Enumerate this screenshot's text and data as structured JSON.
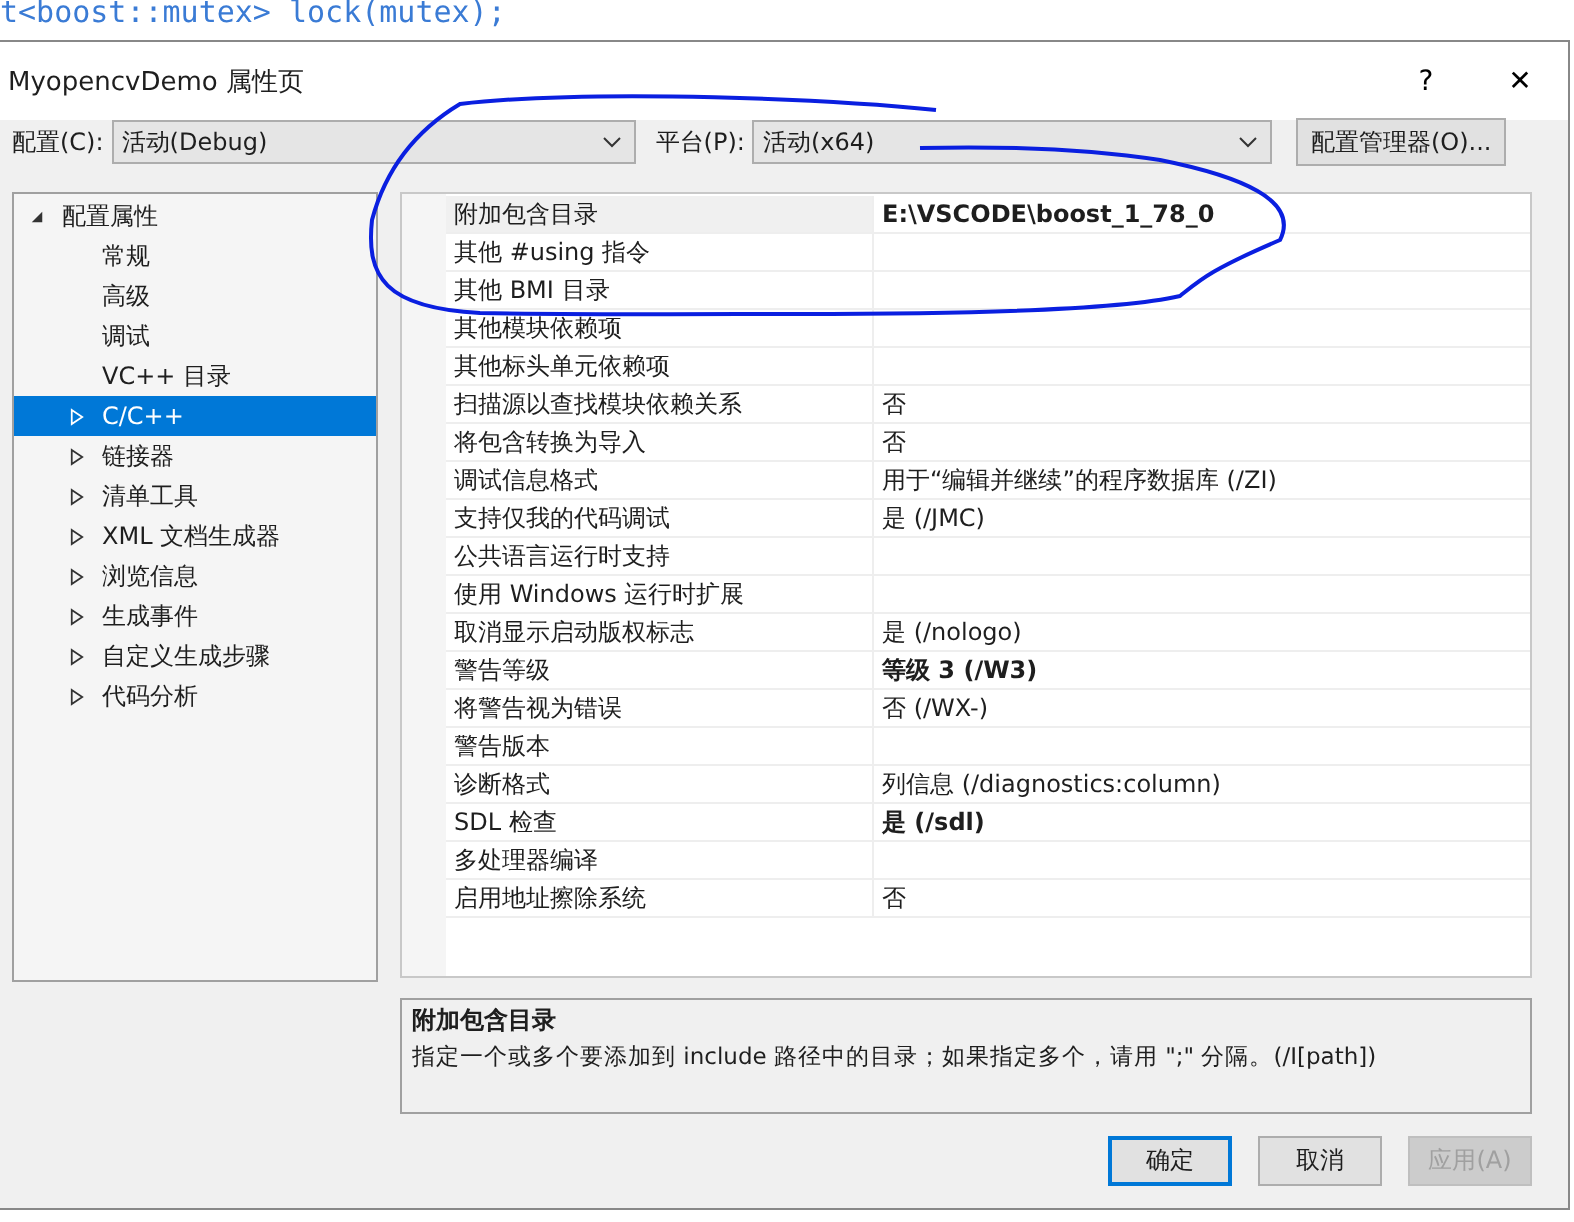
{
  "background_code": "t<boost::mutex> lock(mutex);",
  "window": {
    "title": "MyopencvDemo 属性页",
    "help": "?",
    "close": "✕"
  },
  "config_bar": {
    "config_label": "配置(C):",
    "config_value": "活动(Debug)",
    "platform_label": "平台(P):",
    "platform_value": "活动(x64)",
    "manager_button": "配置管理器(O)..."
  },
  "sidebar": {
    "items": [
      {
        "label": "配置属性",
        "expanded": true,
        "selected": false,
        "children": [
          {
            "label": "常规",
            "selected": false
          },
          {
            "label": "高级",
            "selected": false
          },
          {
            "label": "调试",
            "selected": false
          },
          {
            "label": "VC++ 目录",
            "selected": false
          },
          {
            "label": "C/C++",
            "expanded": false,
            "selected": true
          },
          {
            "label": "链接器",
            "expanded": false,
            "selected": false
          },
          {
            "label": "清单工具",
            "expanded": false,
            "selected": false
          },
          {
            "label": "XML 文档生成器",
            "expanded": false,
            "selected": false
          },
          {
            "label": "浏览信息",
            "expanded": false,
            "selected": false
          },
          {
            "label": "生成事件",
            "expanded": false,
            "selected": false
          },
          {
            "label": "自定义生成步骤",
            "expanded": false,
            "selected": false
          },
          {
            "label": "代码分析",
            "expanded": false,
            "selected": false
          }
        ]
      }
    ]
  },
  "properties": [
    {
      "name": "附加包含目录",
      "value": "E:\\VSCODE\\boost_1_78_0",
      "bold": true,
      "selected": true
    },
    {
      "name": "其他 #using 指令",
      "selected": false
    },
    {
      "name": "其他 BMI 目录",
      "selected": false
    },
    {
      "name": "其他模块依赖项",
      "selected": false
    },
    {
      "name": "其他标头单元依赖项",
      "selected": false
    },
    {
      "name": "扫描源以查找模块依赖关系",
      "value": "否",
      "bold": false,
      "selected": false
    },
    {
      "name": "将包含转换为导入",
      "value": "否",
      "bold": false,
      "selected": false
    },
    {
      "name": "调试信息格式",
      "value": "用于“编辑并继续”的程序数据库 (/ZI)",
      "bold": false,
      "selected": false
    },
    {
      "name": "支持仅我的代码调试",
      "value": "是 (/JMC)",
      "bold": false,
      "selected": false
    },
    {
      "name": "公共语言运行时支持",
      "selected": false
    },
    {
      "name": "使用 Windows 运行时扩展",
      "selected": false
    },
    {
      "name": "取消显示启动版权标志",
      "value": "是 (/nologo)",
      "bold": false,
      "selected": false
    },
    {
      "name": "警告等级",
      "value": "等级 3 (/W3)",
      "bold": true,
      "selected": false
    },
    {
      "name": "将警告视为错误",
      "value": "否 (/WX-)",
      "bold": false,
      "selected": false
    },
    {
      "name": "警告版本",
      "selected": false
    },
    {
      "name": "诊断格式",
      "value": "列信息 (/diagnostics:column)",
      "bold": false,
      "selected": false
    },
    {
      "name": "SDL 检查",
      "value": "是 (/sdl)",
      "bold": true,
      "selected": false
    },
    {
      "name": "多处理器编译",
      "selected": false
    },
    {
      "name": "启用地址擦除系统",
      "value": "否",
      "bold": false,
      "selected": false
    }
  ],
  "description": {
    "title": "附加包含目录",
    "text": "指定一个或多个要添加到 include 路径中的目录；如果指定多个，请用 \";\" 分隔。(/I[path])"
  },
  "buttons": [
    {
      "label": "确定",
      "kind": "default",
      "disabled": false
    },
    {
      "label": "取消",
      "kind": "normal",
      "disabled": false
    },
    {
      "label": "应用(A)",
      "kind": "normal",
      "disabled": true
    }
  ]
}
